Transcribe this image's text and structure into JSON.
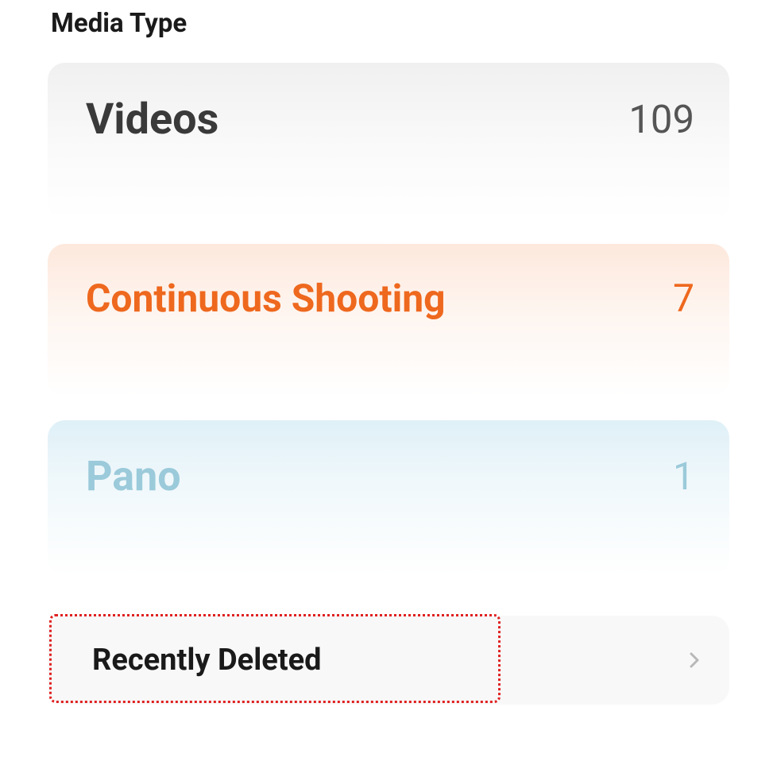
{
  "header": {
    "title": "Media Type"
  },
  "media_types": {
    "videos": {
      "label": "Videos",
      "count": "109"
    },
    "continuous": {
      "label": "Continuous Shooting",
      "count": "7"
    },
    "pano": {
      "label": "Pano",
      "count": "1"
    }
  },
  "recently_deleted": {
    "label": "Recently Deleted"
  }
}
